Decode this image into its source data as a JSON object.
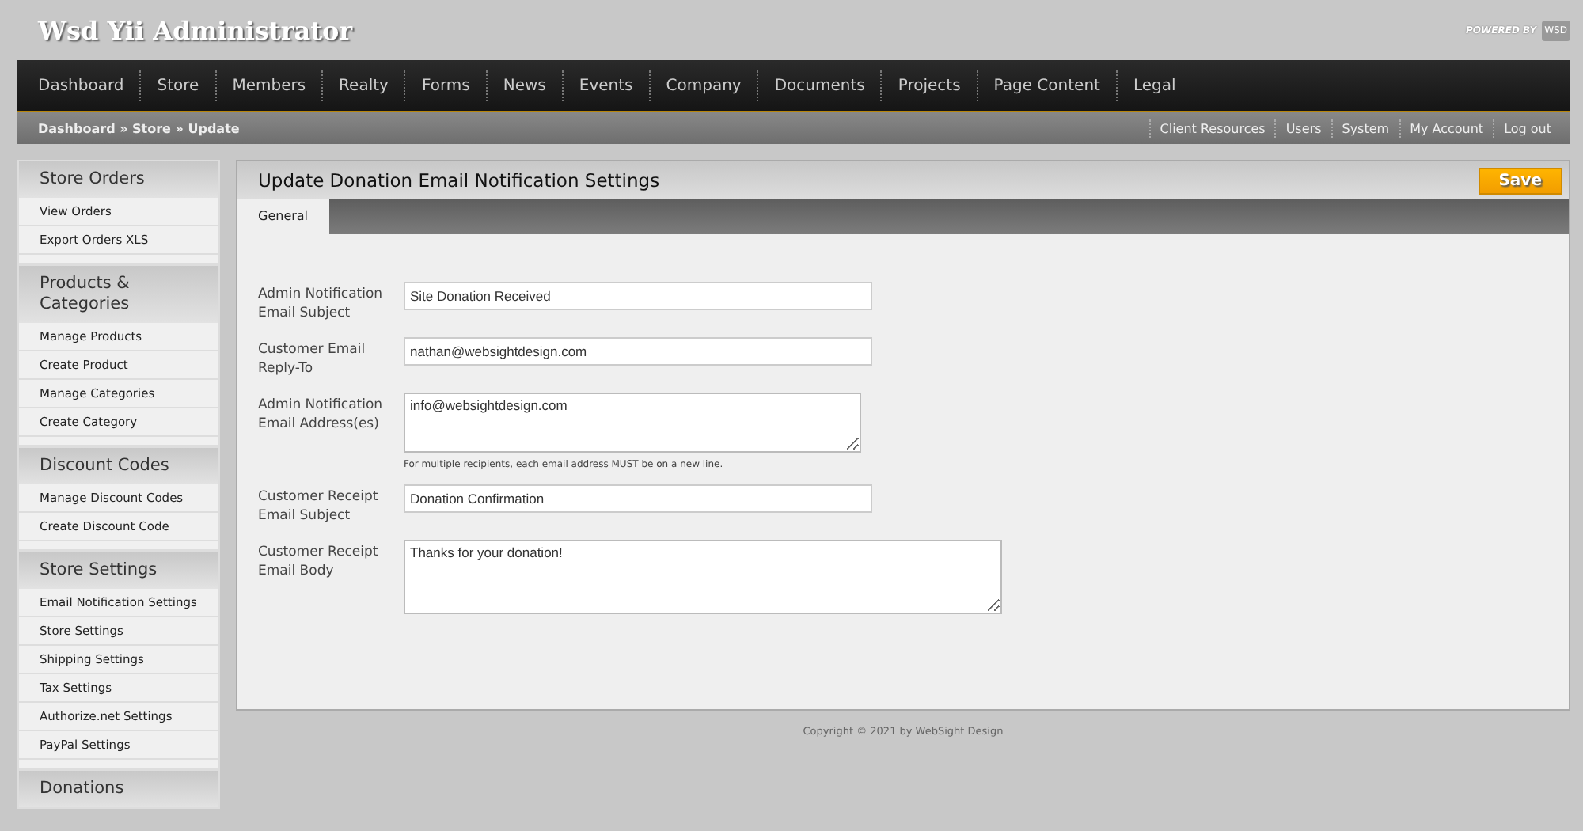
{
  "header": {
    "title": "Wsd Yii Administrator",
    "powered_by": "POWERED BY",
    "logo": "WSD"
  },
  "nav": [
    {
      "label": "Dashboard"
    },
    {
      "label": "Store"
    },
    {
      "label": "Members"
    },
    {
      "label": "Realty"
    },
    {
      "label": "Forms"
    },
    {
      "label": "News"
    },
    {
      "label": "Events"
    },
    {
      "label": "Company"
    },
    {
      "label": "Documents"
    },
    {
      "label": "Projects"
    },
    {
      "label": "Page Content"
    },
    {
      "label": "Legal"
    }
  ],
  "breadcrumb": "Dashboard » Store » Update",
  "user_links": [
    "Client Resources",
    "Users",
    "System",
    "My Account",
    "Log out"
  ],
  "sidebar": [
    {
      "title": "Store Orders",
      "items": [
        "View Orders",
        "Export Orders XLS"
      ]
    },
    {
      "title": "Products & Categories",
      "items": [
        "Manage Products",
        "Create Product",
        "Manage Categories",
        "Create Category"
      ]
    },
    {
      "title": "Discount Codes",
      "items": [
        "Manage Discount Codes",
        "Create Discount Code"
      ]
    },
    {
      "title": "Store Settings",
      "items": [
        "Email Notification Settings",
        "Store Settings",
        "Shipping Settings",
        "Tax Settings",
        "Authorize.net Settings",
        "PayPal Settings"
      ]
    },
    {
      "title": "Donations"
    }
  ],
  "panel": {
    "title": "Update Donation Email Notification Settings",
    "save": "Save",
    "tabs": [
      {
        "label": "General",
        "selected": true
      }
    ],
    "fields": [
      {
        "kind": "input",
        "label": "Admin Notification Email Subject",
        "value": "Site Donation Received"
      },
      {
        "kind": "input",
        "label": "Customer Email Reply-To",
        "value": "nathan@websightdesign.com"
      },
      {
        "kind": "textarea",
        "label": "Admin Notification Email Address(es)",
        "value": "info@websightdesign.com",
        "hint": "For multiple recipients, each email address MUST be on a new line."
      },
      {
        "kind": "input",
        "label": "Customer Receipt Email Subject",
        "value": "Donation Confirmation"
      },
      {
        "kind": "bigtextarea",
        "label": "Customer Receipt Email Body",
        "value": "Thanks for your donation!"
      }
    ]
  },
  "footer": "Copyright © 2021 by WebSight Design"
}
